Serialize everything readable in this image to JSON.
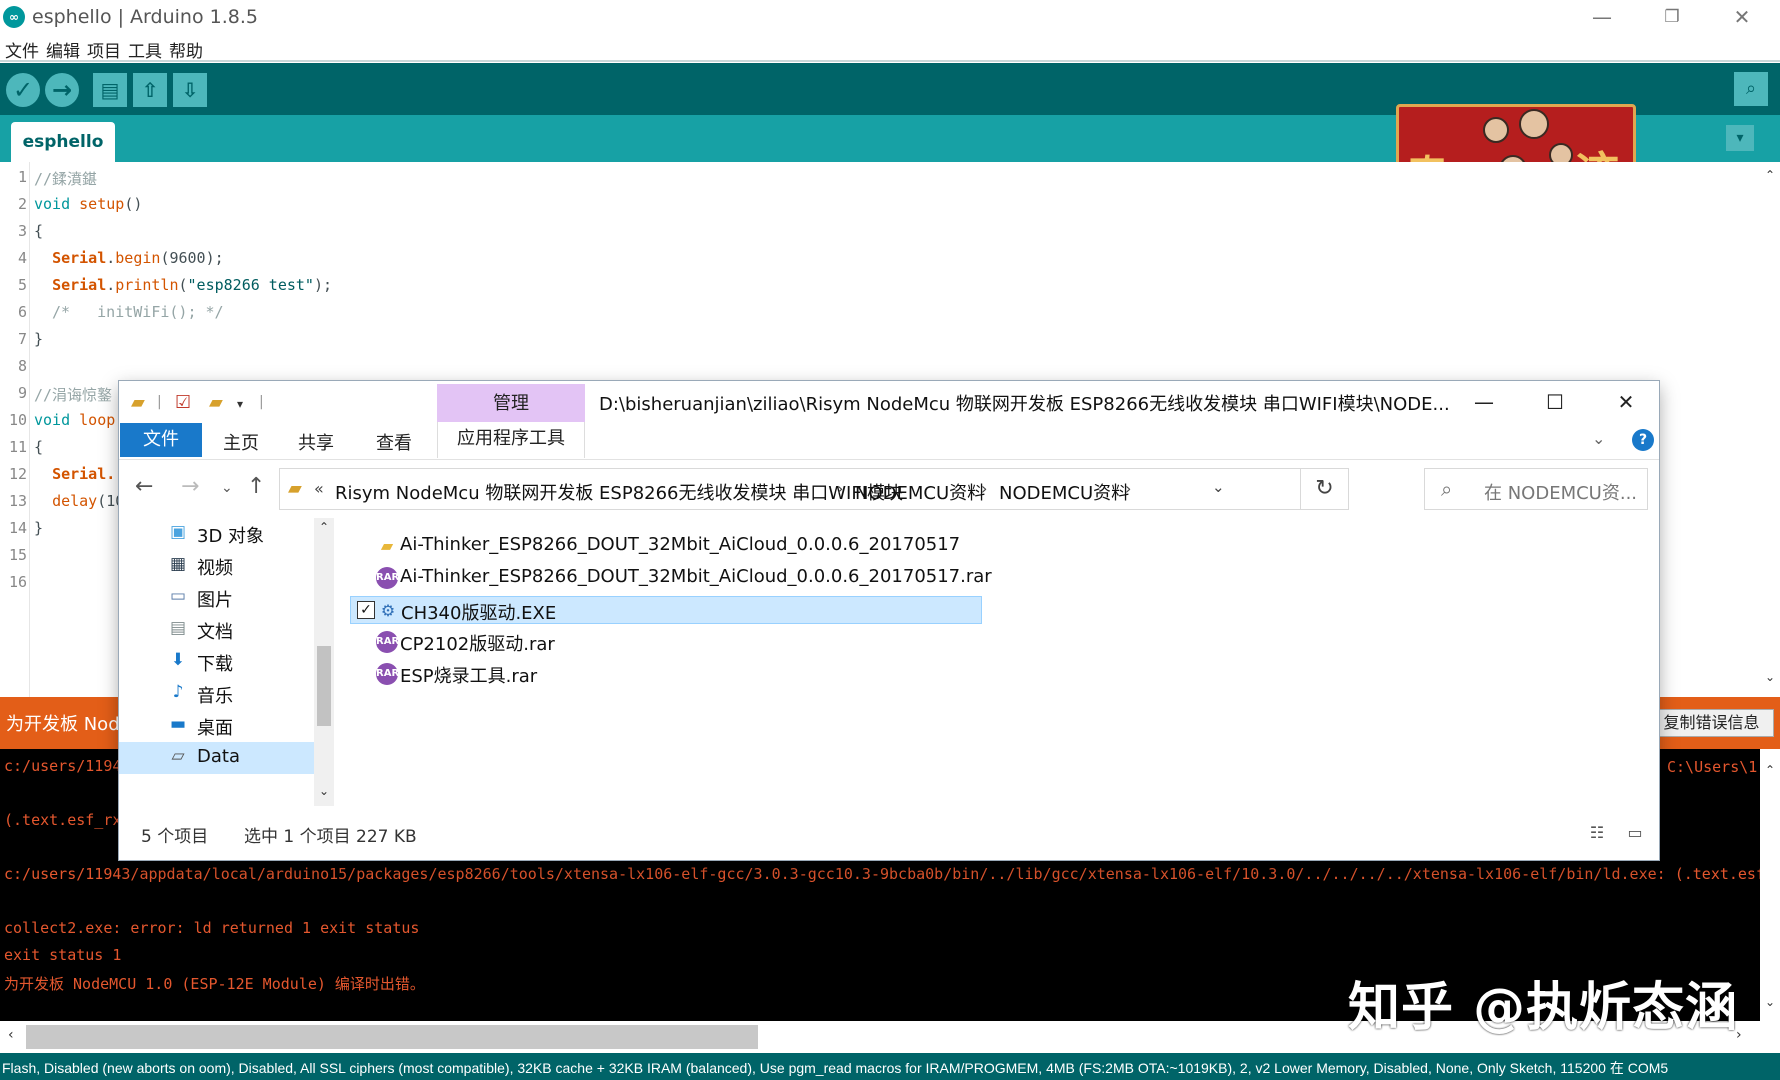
{
  "window": {
    "title": "esphello | Arduino 1.8.5",
    "app_icon": "∞",
    "minimize": "—",
    "maximize": "❐",
    "close": "✕"
  },
  "menu": [
    "文件",
    "编辑",
    "项目",
    "工具",
    "帮助"
  ],
  "toolbar": {
    "verify_icon": "✓",
    "upload_icon": "→",
    "new_icon": "▤",
    "open_icon": "⇧",
    "save_icon": "⇩",
    "serial_icon": "⌕"
  },
  "tabs": {
    "active": "esphello",
    "menu_icon": "▾"
  },
  "editor": {
    "line_numbers": [
      "1",
      "2",
      "3",
      "4",
      "5",
      "6",
      "7",
      "8",
      "9",
      "10",
      "11",
      "12",
      "13",
      "14",
      "15",
      "16"
    ],
    "lines": {
      "l1": "//鍒濆鍖",
      "l2_kw": "void",
      "l2_fn": "setup",
      "l2_rest": "()",
      "l3": "{",
      "l4_cls": "Serial",
      "l4_fn": "begin",
      "l4_rest": "(9600);",
      "l5_cls": "Serial",
      "l5_fn": "println",
      "l5_str": "\"esp8266 test\"",
      "l5_rest": ");",
      "l6": "/*   initWiFi(); */",
      "l7": "}",
      "l9": "//涓诲惊鐜",
      "l10_kw": "void",
      "l10_fn": "loop",
      "l11": "{",
      "l12_cls": "Serial.",
      "l13_fn": "delay",
      "l13_rest": "(10",
      "l14": "}"
    },
    "scroll_up": "⌃",
    "scroll_down": "⌄"
  },
  "error_bar": {
    "text": "为开发板 Node",
    "copy_button": "复制错误信息"
  },
  "console": {
    "lines": [
      "c:/users/1194",
      "",
      "(.text.esf_rx",
      "",
      "c:/users/11943/appdata/local/arduino15/packages/esp8266/tools/xtensa-lx106-elf-gcc/3.0.3-gcc10.3-9bcba0b/bin/../lib/gcc/xtensa-lx106-elf/10.3.0/../../../../xtensa-lx106-elf/bin/ld.exe: (.text.esf",
      "",
      "collect2.exe: error: ld returned 1 exit status",
      "exit status 1",
      "为开发板 NodeMCU 1.0 (ESP-12E Module) 编译时出错。"
    ],
    "right_path": "C:\\Users\\1",
    "scroll_left": "‹",
    "scroll_right": "›"
  },
  "statusbar": {
    "text": "Flash, Disabled (new aborts on oom), Disabled, All SSL ciphers (most compatible), 32KB cache + 32KB IRAM (balanced), Use pgm_read macros for IRAM/PROGMEM, 4MB (FS:2MB OTA:~1019KB), 2, v2 Lower Memory, Disabled, None, Only Sketch, 115200 在 COM5"
  },
  "watermark": "知乎 @执炘态涵",
  "explorer": {
    "title_path": "D:\\bisheruanjian\\ziliao\\Risym NodeMcu 物联网开发板 ESP8266无线收发模块 串口WIFI模块\\NODE...",
    "manage_tab": "管理",
    "ribbon": {
      "file": "文件",
      "home": "主页",
      "share": "共享",
      "view": "查看",
      "app_tools": "应用程序工具",
      "expand_icon": "⌄",
      "help": "?"
    },
    "nav": {
      "back": "←",
      "forward": "→",
      "recent": "⌄",
      "up": "↑",
      "refresh": "↻"
    },
    "breadcrumb": {
      "overflow": "«",
      "items": [
        "Risym NodeMcu 物联网开发板 ESP8266无线收发模块 串口WIFI模块",
        "NODEMCU资料",
        "NODEMCU资料"
      ],
      "sep": "›",
      "dropdown": "⌄"
    },
    "search": {
      "placeholder": "在 NODEMCU资...",
      "icon": "⌕"
    },
    "nav_pane": [
      {
        "label": "3D 对象",
        "icon": "▣"
      },
      {
        "label": "视频",
        "icon": "▦"
      },
      {
        "label": "图片",
        "icon": "▭"
      },
      {
        "label": "文档",
        "icon": "▤"
      },
      {
        "label": "下载",
        "icon": "⬇"
      },
      {
        "label": "音乐",
        "icon": "♪"
      },
      {
        "label": "桌面",
        "icon": "▬"
      },
      {
        "label": "Data",
        "icon": "▱"
      }
    ],
    "files": [
      {
        "name": "Ai-Thinker_ESP8266_DOUT_32Mbit_AiCloud_0.0.0.6_20170517",
        "icon": "▰",
        "type": "folder"
      },
      {
        "name": "Ai-Thinker_ESP8266_DOUT_32Mbit_AiCloud_0.0.0.6_20170517.rar",
        "icon": "RAR",
        "type": "rar"
      },
      {
        "name": "CH340版驱动.EXE",
        "icon": "⚙",
        "type": "exe",
        "checked": "✓"
      },
      {
        "name": "CP2102版驱动.rar",
        "icon": "RAR",
        "type": "rar"
      },
      {
        "name": "ESP烧录工具.rar",
        "icon": "RAR",
        "type": "rar"
      }
    ],
    "status": {
      "count": "5 个项目",
      "selected": "选中 1 个项目  227 KB",
      "details_view_icon": "☷",
      "preview_view_icon": "▭"
    },
    "minimize": "—",
    "maximize": "☐",
    "close": "✕"
  },
  "colors": {
    "toolbar": "#006468",
    "tabbar": "#17a1a5",
    "error": "#e35e18",
    "console_text": "#e4572e",
    "ribbon_file": "#1979ca",
    "manage": "#e3c4f5"
  }
}
